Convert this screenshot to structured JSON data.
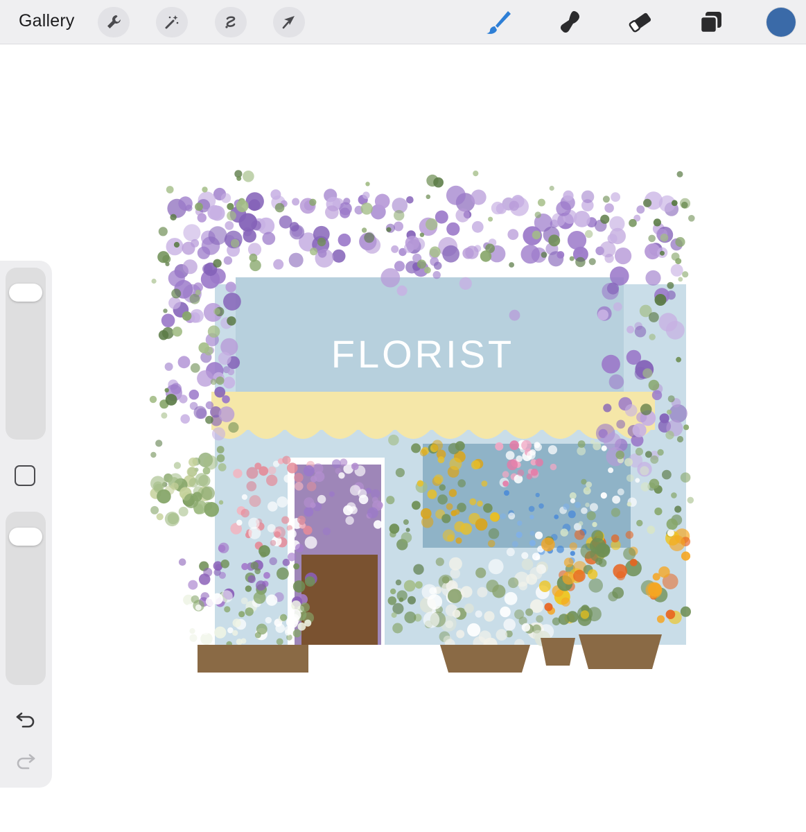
{
  "topbar": {
    "gallery_label": "Gallery",
    "left_tools": [
      "wrench-icon",
      "magic-wand-icon",
      "selection-icon",
      "transform-arrow-icon"
    ],
    "right_tools": [
      "brush-icon",
      "smudge-icon",
      "eraser-icon",
      "layers-icon"
    ],
    "active_tool": "brush-icon",
    "current_color": "#3a6aa8"
  },
  "sidebar": {
    "brush_size_level": 0.08,
    "opacity_level": 0.08,
    "undo_icon": "undo-icon",
    "redo_icon": "redo-icon"
  },
  "canvas": {
    "sign_text": "FLORIST",
    "colors": {
      "wall": "#c9dde8",
      "awning": "#f5e7a8",
      "wisteria": "#9b79c9",
      "leaves": "#6f8f55",
      "pot": "#8a6a45"
    }
  }
}
